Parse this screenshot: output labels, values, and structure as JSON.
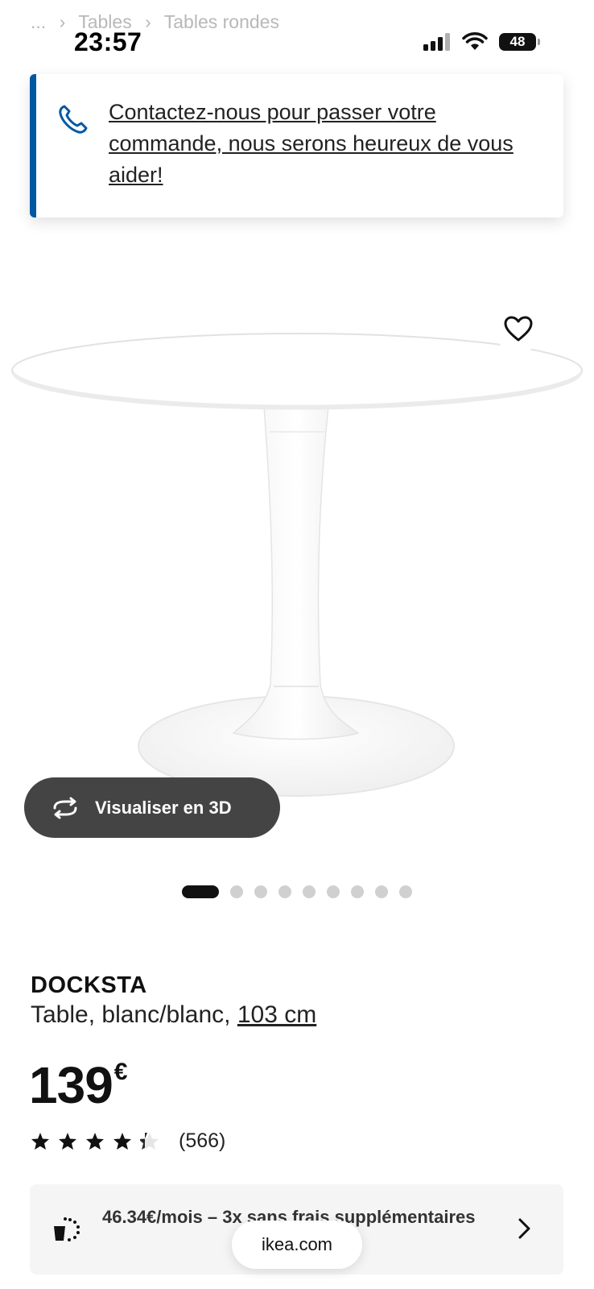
{
  "breadcrumb": {
    "ellipsis": "...",
    "items": [
      "Tables",
      "Tables rondes"
    ]
  },
  "status_bar": {
    "time": "23:57",
    "battery": "48"
  },
  "contact_banner": {
    "text": "Contactez-nous pour passer votre commande, nous serons heureux de vous aider!"
  },
  "gallery": {
    "view_3d_label": "Visualiser en 3D",
    "slide_count": 9,
    "active_slide": 1
  },
  "product": {
    "name": "DOCKSTA",
    "description_prefix": "Table, blanc/blanc,",
    "size_link": "103 cm",
    "price": "139",
    "currency": "€",
    "rating_value": 4,
    "rating_max": 5,
    "review_count": "(566)"
  },
  "financing": {
    "text": "46.34€/mois – 3x sans frais supplémentaires"
  },
  "browser": {
    "url": "ikea.com"
  },
  "colors": {
    "accent": "#0058a3",
    "button_dark": "#444444"
  }
}
